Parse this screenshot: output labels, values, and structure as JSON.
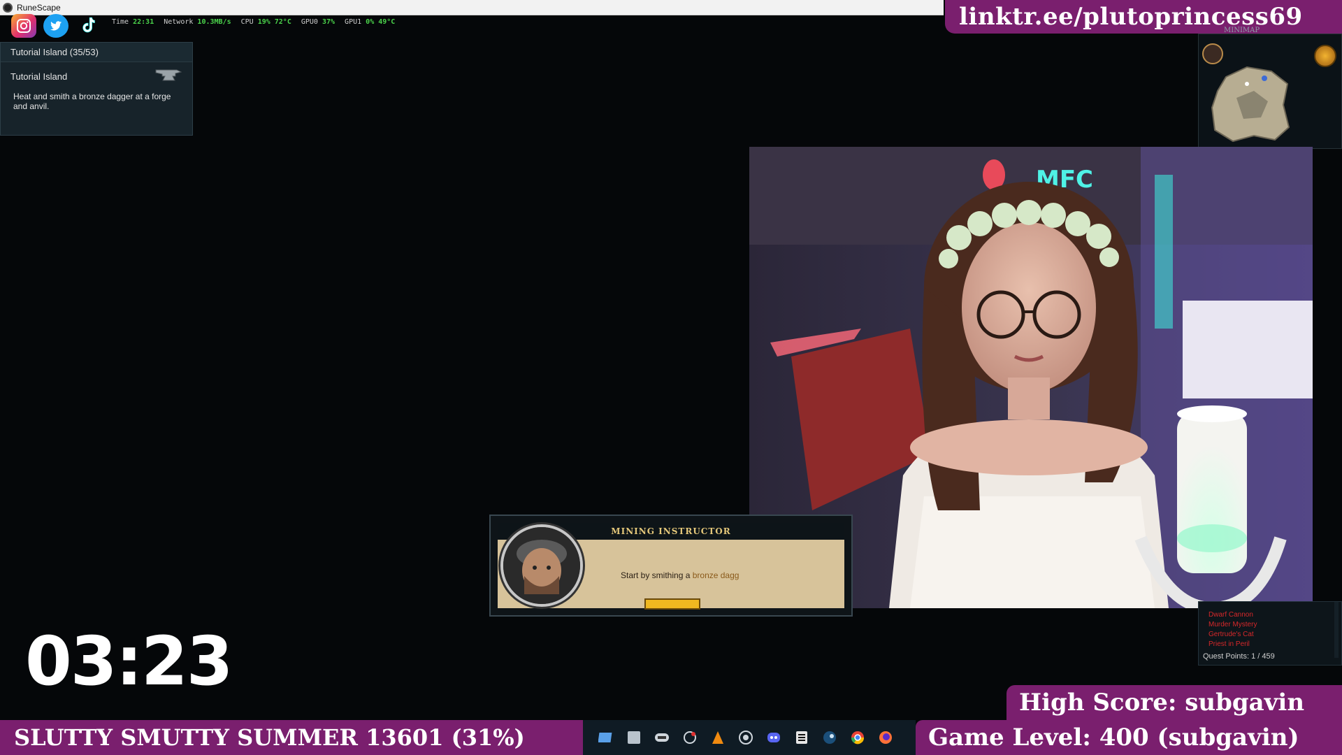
{
  "window": {
    "title": "RuneScape"
  },
  "overlay": {
    "link": "linktr.ee/plutoprincess69",
    "timer": "03:23",
    "high_score": "High Score: subgavin",
    "game_level": "Game Level: 400 (subgavin)",
    "goal_bar": "SLUTTY SMUTTY SUMMER 13601 (31%)"
  },
  "perf": [
    {
      "k": "Time",
      "v": "22:31"
    },
    {
      "k": "Network",
      "v": "10.3MB/s"
    },
    {
      "k": "CPU",
      "v": "19%  72°C"
    },
    {
      "k": "GPU0",
      "v": "37%"
    },
    {
      "k": "GPU1",
      "v": "0%   49°C"
    }
  ],
  "socials": [
    "instagram-icon",
    "twitter-icon",
    "tiktok-icon"
  ],
  "quest": {
    "header": "Tutorial Island (35/53)",
    "name": "Tutorial Island",
    "description": "Heat and smith a bronze dagger at a forge and anvil."
  },
  "minimap": {
    "label": "MINIMAP"
  },
  "quest_list": {
    "items": [
      "Dwarf Cannon",
      "Murder Mystery",
      "Gertrude's Cat",
      "Priest in Peril"
    ],
    "points": "Quest Points: 1 / 459"
  },
  "dialog": {
    "speaker": "MINING INSTRUCTOR",
    "text_prefix": "Start by smithing a",
    "text_highlight": "bronze dagg"
  },
  "taskbar": [
    "file-explorer-icon",
    "window-icon",
    "keyboard-icon",
    "steam-scan-icon",
    "vlc-icon",
    "obs-icon",
    "discord-icon",
    "epic-icon",
    "steam-icon",
    "chrome-icon",
    "firefox-icon"
  ],
  "colors": {
    "brand_purple": "#7a1f6e",
    "stat_green": "#4bd34b",
    "dialog_gold": "#e4c77a"
  }
}
